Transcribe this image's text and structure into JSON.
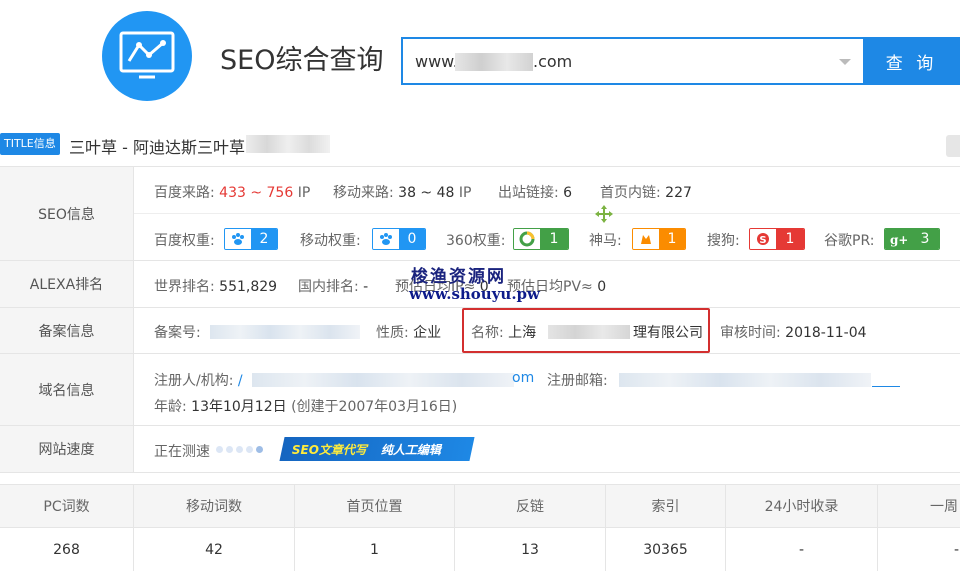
{
  "header": {
    "brand": "SEO综合查询",
    "search_value": "www.              .com",
    "search_prefix": "www.",
    "search_suffix": ".com",
    "search_button": "查 询"
  },
  "title_row": {
    "tag": "TITLE信息",
    "text": "三叶草 - 阿迪达斯三叶草"
  },
  "seo_info": {
    "label": "SEO信息",
    "baidu_source_label": "百度来路:",
    "baidu_source_value": "433 ~ 756",
    "baidu_source_unit": "IP",
    "mobile_source_label": "移动来路:",
    "mobile_source_value": "38 ~ 48",
    "mobile_source_unit": "IP",
    "outbound_label": "出站链接:",
    "outbound_value": "6",
    "inner_label": "首页内链:",
    "inner_value": "227",
    "weights": [
      {
        "label": "百度权重:",
        "value": "2",
        "icon": "paw-icon",
        "color": "#2196f3"
      },
      {
        "label": "移动权重:",
        "value": "0",
        "icon": "paw-icon",
        "color": "#2196f3"
      },
      {
        "label": "360权重:",
        "value": "1",
        "icon": "360-icon",
        "color": "#43a047"
      },
      {
        "label": "神马:",
        "value": "1",
        "icon": "shenma-icon",
        "color": "#fb8c00"
      },
      {
        "label": "搜狗:",
        "value": "1",
        "icon": "sogou-icon",
        "color": "#e53935"
      },
      {
        "label": "谷歌PR:",
        "value": "3",
        "icon": "google-plus-icon",
        "color": "#43a047"
      }
    ]
  },
  "alexa": {
    "label": "ALEXA排名",
    "world_label": "世界排名:",
    "world_value": "551,829",
    "domestic_label": "国内排名:",
    "domestic_value": "-",
    "ip_label": "预估日均IP≈",
    "ip_value": "0",
    "pv_label": "预估日均PV≈",
    "pv_value": "0"
  },
  "beian": {
    "label": "备案信息",
    "no_label": "备案号:",
    "nature_label": "性质:",
    "nature_value": "企业",
    "name_label": "名称:",
    "name_prefix": "上海",
    "name_suffix": "理有限公司",
    "audit_label": "审核时间:",
    "audit_value": "2018-11-04"
  },
  "domain": {
    "label": "域名信息",
    "registrant_label": "注册人/机构:",
    "registrant_prefix": "/",
    "registrant_suffix": "om",
    "email_label": "注册邮箱:",
    "age_label": "年龄:",
    "age_value": "13年10月12日",
    "created": "(创建于2007年03月16日)"
  },
  "speed": {
    "label": "网站速度",
    "status": "正在测速",
    "banner_a": "SEO文章代写",
    "banner_b": "纯人工编辑"
  },
  "watermark": {
    "cn": "梭渔资源网",
    "url": "www.shouyu.pw"
  },
  "stats": {
    "headers": [
      "PC词数",
      "移动词数",
      "首页位置",
      "反链",
      "索引",
      "24小时收录",
      "一周"
    ],
    "values": [
      "268",
      "42",
      "1",
      "13",
      "30365",
      "-",
      "-"
    ]
  }
}
